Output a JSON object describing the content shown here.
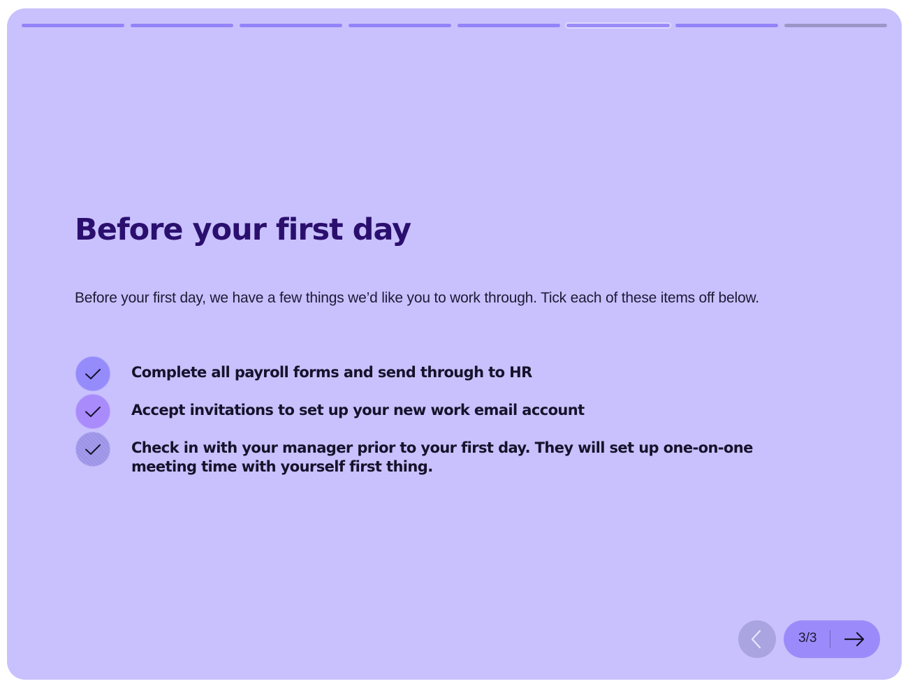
{
  "progress": {
    "total_steps": 8,
    "current_step": 6,
    "colors": {
      "completed": "#9283f9",
      "current": "#9a8cf8",
      "pending": "#9b96c6"
    }
  },
  "content": {
    "title": "Before your first day",
    "intro": "Before your first day, we have a few things we’d like you to work through. Tick each of these items off below.",
    "checklist": [
      {
        "label": "Complete all payroll forms and send through to HR",
        "checked": true,
        "icon": "check-icon"
      },
      {
        "label": "Accept invitations to set up your new work email account",
        "checked": true,
        "icon": "check-icon"
      },
      {
        "label": "Check in with your manager prior to your first day. They will set up one-on-one meeting time with yourself first thing.",
        "checked": true,
        "icon": "check-icon"
      }
    ]
  },
  "navigation": {
    "prev_icon": "chevron-left-icon",
    "page_indicator": "3/3",
    "next_icon": "arrow-right-icon"
  },
  "theme": {
    "background": "#c8c1fd",
    "title_color": "#2b0f6e",
    "text_color": "#17122b",
    "accent": "#9b8bfa"
  }
}
